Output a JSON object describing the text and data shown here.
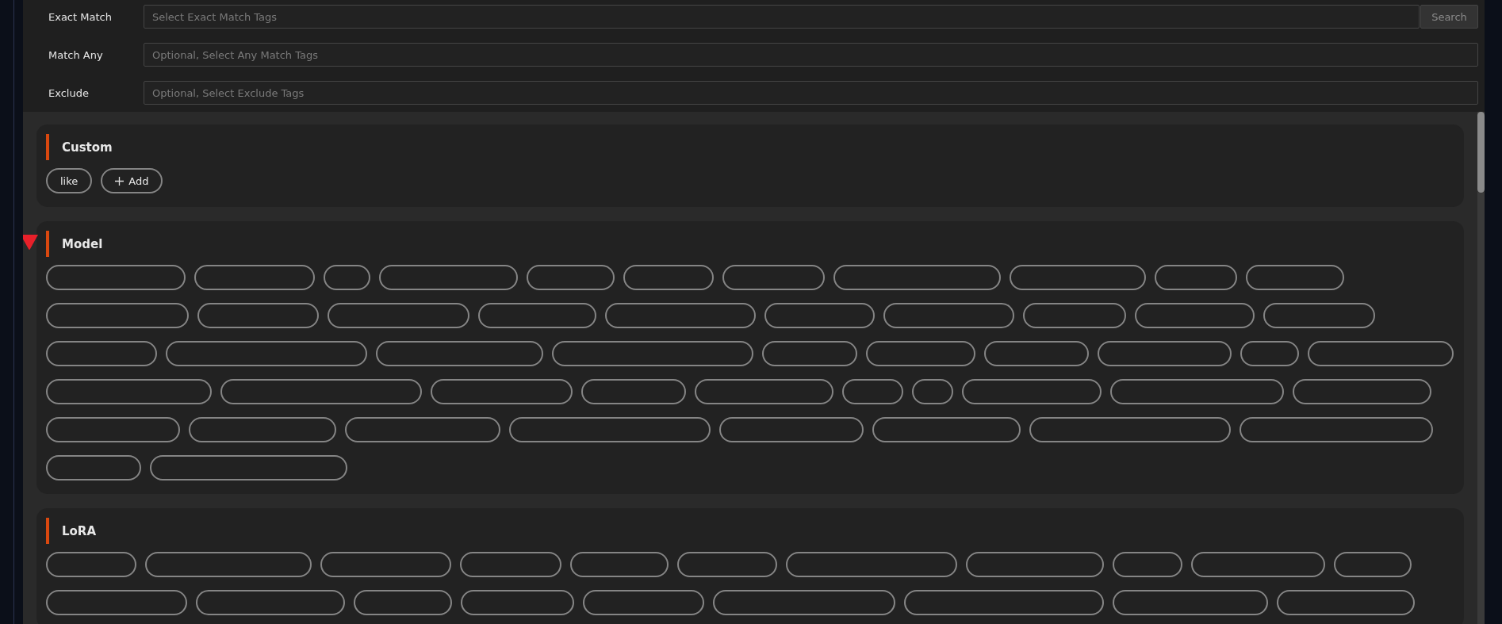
{
  "filters": [
    {
      "label": "Exact Match",
      "placeholder": "Select Exact Match Tags",
      "button": "Search"
    },
    {
      "label": "Match Any",
      "placeholder": "Optional, Select Any Match Tags"
    },
    {
      "label": "Exclude",
      "placeholder": "Optional, Select Exclude Tags"
    }
  ],
  "groups": [
    {
      "title": "Custom",
      "marked": false,
      "tags": [
        {
          "kind": "tag",
          "label": "like"
        },
        {
          "kind": "add",
          "label": "Add"
        }
      ]
    },
    {
      "title": "Model",
      "marked": true,
      "tags": [
        {
          "kind": "blank"
        },
        {
          "kind": "blank"
        },
        {
          "kind": "blank"
        },
        {
          "kind": "blank"
        },
        {
          "kind": "blank"
        },
        {
          "kind": "blank"
        },
        {
          "kind": "blank"
        },
        {
          "kind": "blank"
        },
        {
          "kind": "blank"
        },
        {
          "kind": "blank"
        },
        {
          "kind": "blank"
        },
        {
          "kind": "blank"
        },
        {
          "kind": "blank"
        },
        {
          "kind": "blank"
        },
        {
          "kind": "blank"
        },
        {
          "kind": "blank"
        },
        {
          "kind": "blank"
        },
        {
          "kind": "blank"
        },
        {
          "kind": "blank"
        },
        {
          "kind": "blank"
        },
        {
          "kind": "blank"
        },
        {
          "kind": "blank"
        },
        {
          "kind": "blank"
        },
        {
          "kind": "blank"
        },
        {
          "kind": "blank"
        },
        {
          "kind": "blank"
        },
        {
          "kind": "blank"
        },
        {
          "kind": "blank"
        },
        {
          "kind": "blank"
        },
        {
          "kind": "blank"
        },
        {
          "kind": "blank"
        },
        {
          "kind": "blank"
        },
        {
          "kind": "blank"
        },
        {
          "kind": "blank"
        },
        {
          "kind": "blank"
        },
        {
          "kind": "blank"
        },
        {
          "kind": "blank"
        },
        {
          "kind": "blank"
        },
        {
          "kind": "blank"
        },
        {
          "kind": "blank"
        },
        {
          "kind": "blank"
        },
        {
          "kind": "blank"
        },
        {
          "kind": "blank"
        },
        {
          "kind": "blank"
        },
        {
          "kind": "blank"
        },
        {
          "kind": "blank"
        },
        {
          "kind": "blank"
        },
        {
          "kind": "blank"
        },
        {
          "kind": "blank"
        },
        {
          "kind": "blank"
        },
        {
          "kind": "blank"
        }
      ]
    },
    {
      "title": "LoRA",
      "marked": false,
      "tags": [
        {
          "kind": "blank"
        },
        {
          "kind": "blank"
        },
        {
          "kind": "blank"
        },
        {
          "kind": "blank"
        },
        {
          "kind": "blank"
        },
        {
          "kind": "blank"
        },
        {
          "kind": "blank"
        },
        {
          "kind": "blank"
        },
        {
          "kind": "blank"
        },
        {
          "kind": "blank"
        },
        {
          "kind": "blank"
        },
        {
          "kind": "blank"
        },
        {
          "kind": "blank"
        },
        {
          "kind": "blank"
        },
        {
          "kind": "blank"
        },
        {
          "kind": "blank"
        },
        {
          "kind": "blank"
        },
        {
          "kind": "blank"
        },
        {
          "kind": "blank"
        },
        {
          "kind": "blank"
        }
      ]
    }
  ]
}
